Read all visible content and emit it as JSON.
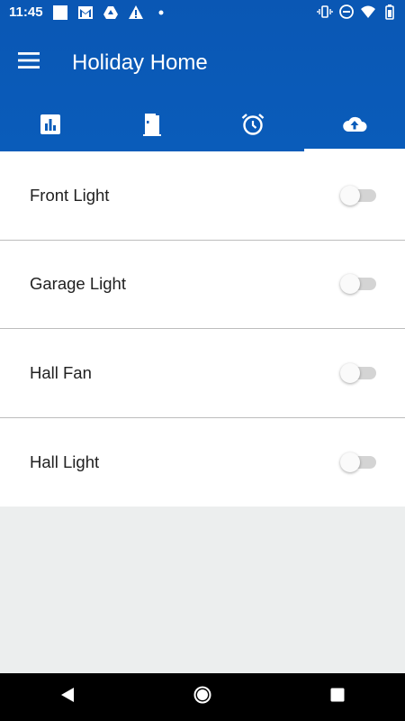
{
  "status_bar": {
    "time": "11:45",
    "left_icons": [
      "square-icon",
      "gmail-icon",
      "drive-icon",
      "warning-icon",
      "dot-icon"
    ],
    "right_icons": [
      "vibrate-icon",
      "dnd-icon",
      "wifi-icon",
      "battery-icon"
    ]
  },
  "toolbar": {
    "title": "Holiday Home",
    "menu_icon": "hamburger-menu-icon"
  },
  "tabs": [
    {
      "icon": "bar-chart-icon",
      "active": false
    },
    {
      "icon": "door-icon",
      "active": false
    },
    {
      "icon": "alarm-clock-icon",
      "active": false
    },
    {
      "icon": "cloud-upload-icon",
      "active": true
    }
  ],
  "devices": [
    {
      "label": "Front Light",
      "on": false
    },
    {
      "label": "Garage Light",
      "on": false
    },
    {
      "label": "Hall Fan",
      "on": false
    },
    {
      "label": "Hall Light",
      "on": false
    }
  ],
  "nav_bar": {
    "buttons": [
      "back-icon",
      "home-icon",
      "recents-icon"
    ]
  },
  "colors": {
    "header": "#0A57B4",
    "background": "#ECEEEE",
    "list_background": "#FFFFFF",
    "text": "#212121"
  }
}
